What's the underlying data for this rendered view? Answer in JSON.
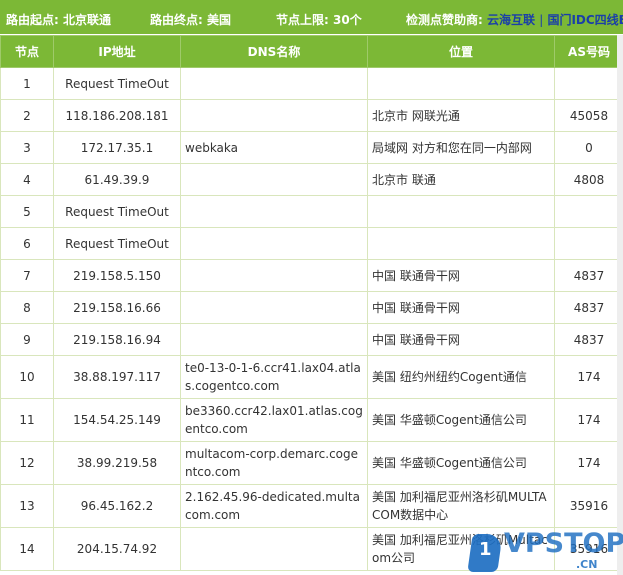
{
  "header": {
    "start_label": "路由起点:",
    "start_value": "北京联通",
    "end_label": "路由终点:",
    "end_value": "美国",
    "hops_label": "节点上限:",
    "hops_value": "30个",
    "sponsor_label": "检测点赞助商:",
    "sponsor_1": "云海互联",
    "sponsor_sep": "|",
    "sponsor_2": "国门IDC四线B"
  },
  "columns": [
    "节点",
    "IP地址",
    "DNS名称",
    "位置",
    "AS号码"
  ],
  "rows": [
    {
      "hop": "1",
      "ip": "Request TimeOut",
      "dns": "",
      "location": "",
      "as": ""
    },
    {
      "hop": "2",
      "ip": "118.186.208.181",
      "dns": "",
      "location": "北京市 网联光通",
      "as": "45058"
    },
    {
      "hop": "3",
      "ip": "172.17.35.1",
      "dns": "webkaka",
      "location": "局域网 对方和您在同一内部网",
      "as": "0"
    },
    {
      "hop": "4",
      "ip": "61.49.39.9",
      "dns": "",
      "location": "北京市 联通",
      "as": "4808"
    },
    {
      "hop": "5",
      "ip": "Request TimeOut",
      "dns": "",
      "location": "",
      "as": ""
    },
    {
      "hop": "6",
      "ip": "Request TimeOut",
      "dns": "",
      "location": "",
      "as": ""
    },
    {
      "hop": "7",
      "ip": "219.158.5.150",
      "dns": "",
      "location": "中国 联通骨干网",
      "as": "4837"
    },
    {
      "hop": "8",
      "ip": "219.158.16.66",
      "dns": "",
      "location": "中国 联通骨干网",
      "as": "4837"
    },
    {
      "hop": "9",
      "ip": "219.158.16.94",
      "dns": "",
      "location": "中国 联通骨干网",
      "as": "4837"
    },
    {
      "hop": "10",
      "ip": "38.88.197.117",
      "dns": "te0-13-0-1-6.ccr41.lax04.atlas.cogentco.com",
      "location": "美国 纽约州纽约Cogent通信",
      "as": "174"
    },
    {
      "hop": "11",
      "ip": "154.54.25.149",
      "dns": "be3360.ccr42.lax01.atlas.cogentco.com",
      "location": "美国 华盛顿Cogent通信公司",
      "as": "174"
    },
    {
      "hop": "12",
      "ip": "38.99.219.58",
      "dns": "multacom-corp.demarc.cogentco.com",
      "location": "美国 华盛顿Cogent通信公司",
      "as": "174"
    },
    {
      "hop": "13",
      "ip": "96.45.162.2",
      "dns": "2.162.45.96-dedicated.multacom.com",
      "location": "美国 加利福尼亚州洛杉矶MULTACOM数据中心",
      "as": "35916"
    },
    {
      "hop": "14",
      "ip": "204.15.74.92",
      "dns": "",
      "location": "美国 加利福尼亚州洛杉矶Multacom公司",
      "as": "35916"
    }
  ],
  "watermark": {
    "badge": "1",
    "text": "VPSTOP",
    "tld": ".CN"
  },
  "colors": {
    "header_green": "#7cb836",
    "link_blue": "#1a3fa8",
    "border": "#d9e6bc"
  }
}
